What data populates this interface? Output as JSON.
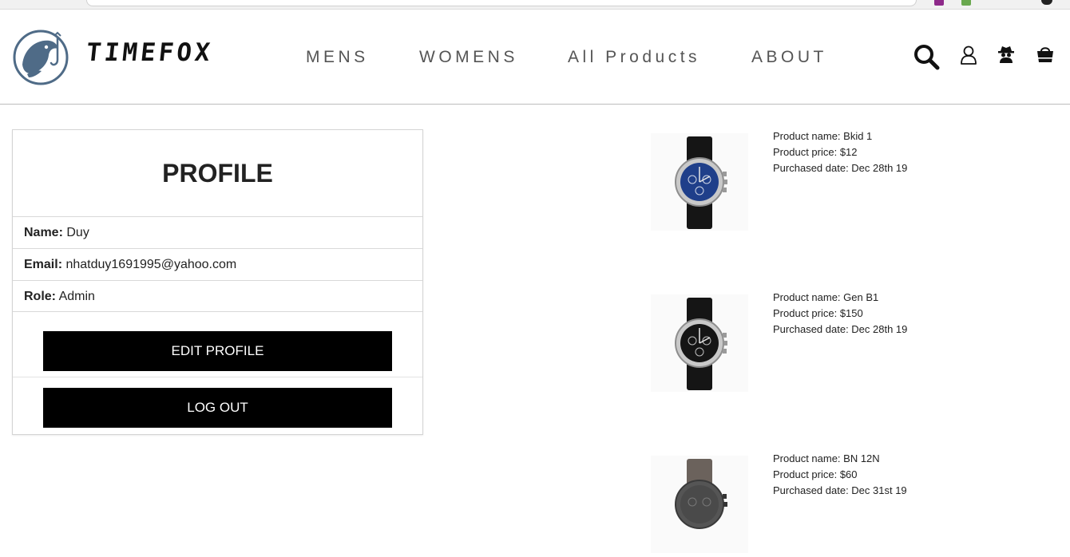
{
  "brand": {
    "name": "TIMEFOX"
  },
  "nav": {
    "mens": "MENS",
    "womens": "WOMENS",
    "all_products": "All Products",
    "about": "ABOUT"
  },
  "header_icons": [
    "search-icon",
    "user-icon",
    "spy-icon",
    "shopping-bag-icon"
  ],
  "profile": {
    "title": "PROFILE",
    "name_label": "Name:",
    "name_value": "Duy",
    "email_label": "Email:",
    "email_value": "nhatduy1691995@yahoo.com",
    "role_label": "Role:",
    "role_value": "Admin",
    "edit_button": "EDIT PROFILE",
    "logout_button": "LOG OUT"
  },
  "purchases": [
    {
      "name_line": "Product name: Bkid 1",
      "price_line": "Product price: $12",
      "date_line": "Purchased date: Dec 28th 19",
      "dial_color": "#1f3f8a"
    },
    {
      "name_line": "Product name: Gen B1",
      "price_line": "Product price: $150",
      "date_line": "Purchased date: Dec 28th 19",
      "dial_color": "#151515"
    },
    {
      "name_line": "Product name: BN 12N",
      "price_line": "Product price: $60",
      "date_line": "Purchased date: Dec 31st 19",
      "dial_color": "#4a4a4a"
    }
  ],
  "colors": {
    "button_bg": "#000000",
    "logo_blue": "#4f6b87"
  }
}
